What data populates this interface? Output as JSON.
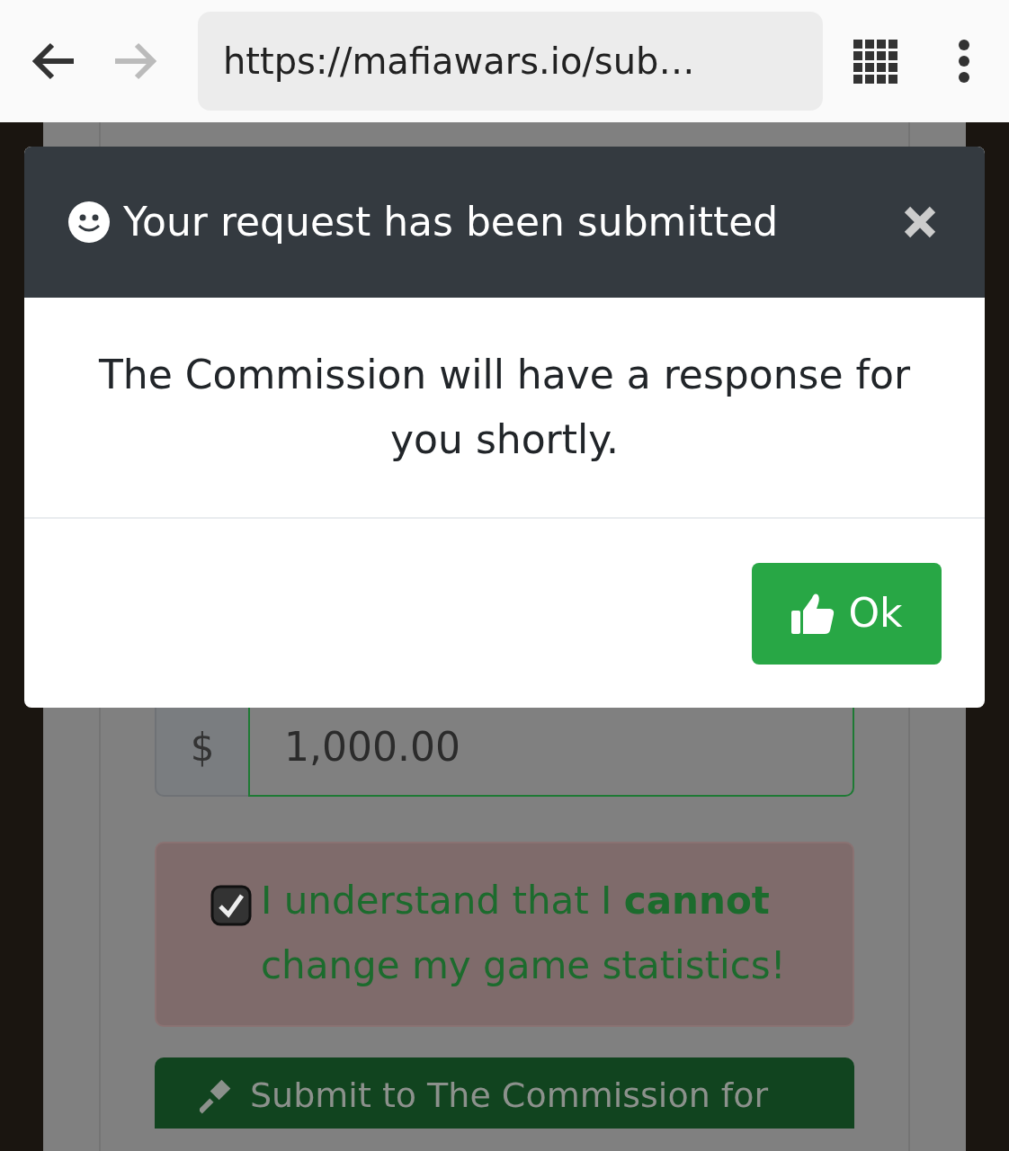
{
  "browser": {
    "back_enabled": true,
    "forward_enabled": false,
    "url": "https://mafiawars.io/sub…"
  },
  "modal": {
    "title": "Your request has been submitted",
    "message": "The Commission will have a response for you shortly.",
    "button": "Ok"
  },
  "form": {
    "currency": "$",
    "amount": "1,000.00",
    "agreement": {
      "checked": true,
      "text": "I understand that I **cannot** change my game statistics!"
    },
    "submit": "Submit to The Commission for"
  }
}
